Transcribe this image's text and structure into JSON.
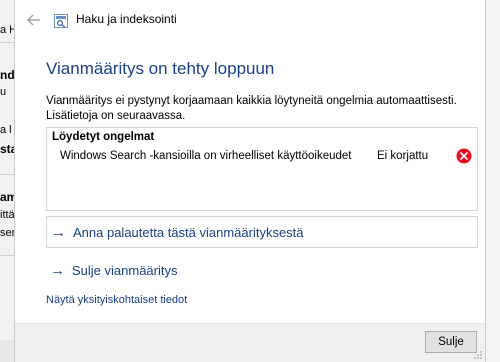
{
  "background": {
    "fragments": [
      "a H",
      "nd",
      "u",
      "a l",
      "sta",
      "ama",
      "ittä",
      "ser"
    ]
  },
  "dialog": {
    "back_icon": "back-arrow-icon",
    "title": "Haku ja indeksointi",
    "heading": "Vianmääritys on tehty loppuun",
    "description": "Vianmääritys ei pystynyt korjaamaan kaikkia löytyneitä ongelmia automaattisesti. Lisätietoja on seuraavassa.",
    "problems": {
      "header": "Löydetyt ongelmat",
      "items": [
        {
          "name": "Windows Search -kansioilla on virheelliset käyttöoikeudet",
          "status": "Ei korjattu",
          "icon": "error-icon"
        }
      ]
    },
    "actions": {
      "feedback": "Anna palautetta tästä vianmäärityksestä",
      "close_troubleshooter": "Sulje vianmääritys"
    },
    "details_link": "Näytä yksityiskohtaiset tiedot",
    "close_button": "Sulje",
    "colors": {
      "accent": "#1a3f86",
      "error": "#e81123"
    }
  }
}
